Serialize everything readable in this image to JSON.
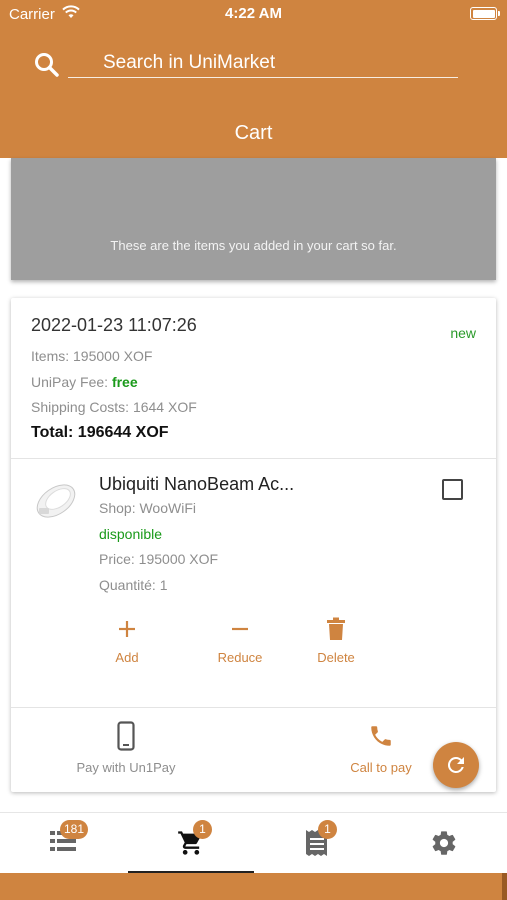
{
  "status_bar": {
    "carrier": "Carrier",
    "time": "4:22 AM"
  },
  "search": {
    "placeholder": "Search in UniMarket"
  },
  "header": {
    "title": "Cart"
  },
  "banner": {
    "text": "These are the items you added in your cart so far."
  },
  "order": {
    "date": "2022-01-23 11:07:26",
    "status": "new",
    "items_label": "Items: 195000 XOF",
    "fee_label": "UniPay Fee: ",
    "fee_value": "free",
    "shipping_label": "Shipping Costs: 1644 XOF",
    "total_label": "Total: 196644 XOF"
  },
  "product": {
    "name": "Ubiquiti NanoBeam Ac...",
    "shop": "Shop: WooWiFi",
    "availability": "disponible",
    "price": "Price: 195000 XOF",
    "quantity": "Quantité: 1"
  },
  "actions": {
    "add": "Add",
    "reduce": "Reduce",
    "delete": "Delete"
  },
  "payment": {
    "unipay": "Pay with Un1Pay",
    "call": "Call to pay"
  },
  "tabbar": {
    "catalog_badge": "181",
    "cart_badge": "1",
    "orders_badge": "1"
  },
  "colors": {
    "accent": "#cf8440",
    "green": "#1a9a1a",
    "banner_grey": "#9e9e9e"
  }
}
